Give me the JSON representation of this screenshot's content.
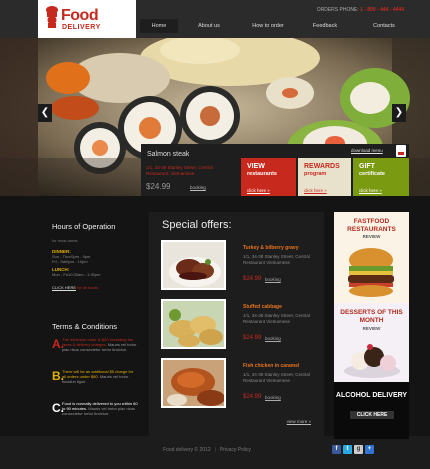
{
  "logo": {
    "line1": "Food",
    "line2": "DELIVERY"
  },
  "header": {
    "phone_label": "ORDERS PHONE:",
    "phone_number": "1 - 800 - 444 - 4444",
    "nav": [
      {
        "label": "Home",
        "active": true
      },
      {
        "label": "About us",
        "active": false
      },
      {
        "label": "How to order",
        "active": false
      },
      {
        "label": "Feedback",
        "active": false
      },
      {
        "label": "Contacts",
        "active": false
      }
    ]
  },
  "slider": {
    "prev_arrow": "❮",
    "next_arrow": "❯",
    "caption_title": "Salmon steak",
    "caption_address": "1/1, 34-38 Stanley Street, Central Restaurant, Vietnamese",
    "caption_price": "$24.99",
    "caption_booking": "booking",
    "download_menu": "download menu",
    "promos": [
      {
        "title": "VIEW",
        "subtitle": "restaurants",
        "link": "click here »"
      },
      {
        "title": "REWARDS",
        "subtitle": "program",
        "link": "click here »"
      },
      {
        "title": "GIFT",
        "subtitle": "certificate",
        "link": "click here »"
      }
    ]
  },
  "hours": {
    "title": "Hours of Operation",
    "note": "for most areas",
    "dinner_label": "DINNER:",
    "dinner_lines": [
      "Sun - ThurSpm - 9pm",
      "Fri - Sat5pm - 10pm"
    ],
    "lunch_label": "LUNCH:",
    "lunch_lines": [
      "Mon - Fri10:30am - 1:30pm"
    ],
    "click_label": "CLICK HERE",
    "click_suffix": "for all hours"
  },
  "terms": {
    "title": "Terms & Conditions",
    "items": [
      {
        "letter": "A.",
        "color": "#c62a1e",
        "highlight": "The minimum order is $20 excluding the taxes & delivery charges.",
        "rest": "Mauris vel tortor plac risus consectetur tortor tincidun."
      },
      {
        "letter": "B.",
        "color": "#e1b100",
        "highlight": "There will be an additional $5 charge for all orders under $80.",
        "rest": "Mauris vel tortor tincidun ligue."
      },
      {
        "letter": "C.",
        "color": "#ffffff",
        "highlight": "Food is normally delivered to you within 60 to 90 minutes.",
        "rest": "Mauris vel tortor plac risus consectetur tortor tincidun."
      }
    ]
  },
  "special": {
    "title": "Special offers:",
    "items": [
      {
        "name": "Turkey & bilberry gravy",
        "address": "1/1, 34-38 Stanley Street, Central Restaurant Vietnamese",
        "price": "$24.99",
        "booking": "booking"
      },
      {
        "name": "Stuffed cabbage",
        "address": "1/1, 34-38 Stanley Street, Central Restaurant Vietnamese",
        "price": "$24.99",
        "booking": "booking"
      },
      {
        "name": "Fish chicken in caramel",
        "address": "1/1, 34-38 Stanley Street, Central Restaurant Vietnamese",
        "price": "$24.99",
        "booking": "booking"
      }
    ],
    "more": "view more »"
  },
  "ads": {
    "ad1_title": "FASTFOOD RESTAURANTS",
    "ad1_sub": "REVIEW",
    "ad2_title": "DESSERTS OF THIS MONTH",
    "ad2_sub": "REVIEW",
    "ad3_title": "ALCOHOL DELIVERY",
    "ad3_button": "CLICK HERE"
  },
  "footer": {
    "copyright": "Food delivery © 2012",
    "separator": "|",
    "privacy": "Privacy Policy",
    "socials": [
      {
        "name": "facebook",
        "glyph": "f",
        "color": "#3b5998"
      },
      {
        "name": "twitter",
        "glyph": "t",
        "color": "#29a9e1"
      },
      {
        "name": "google",
        "glyph": "g",
        "color": "#cccccc"
      },
      {
        "name": "delicious",
        "glyph": "+",
        "color": "#3274d1"
      }
    ]
  },
  "colors": {
    "brand_red": "#c62a1e",
    "brand_yellow": "#e1b100",
    "brand_green": "#7a9a12"
  }
}
